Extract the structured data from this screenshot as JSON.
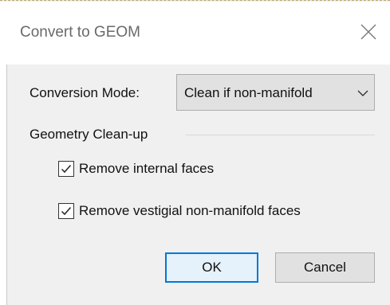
{
  "dialog": {
    "title": "Convert to GEOM",
    "conversion_mode": {
      "label": "Conversion Mode:",
      "selected": "Clean if non-manifold"
    },
    "group": {
      "label": "Geometry Clean-up",
      "options": [
        {
          "label": "Remove internal faces",
          "checked": true
        },
        {
          "label": "Remove vestigial non-manifold faces",
          "checked": true
        }
      ]
    },
    "buttons": {
      "ok": "OK",
      "cancel": "Cancel"
    }
  },
  "icons": {
    "close": "close-icon",
    "dropdown": "chevron-down-icon",
    "checkmark": "checkmark-icon"
  },
  "colors": {
    "accent": "#0078d7",
    "dialog_bg": "#f0f0f0",
    "title_bg": "#ffffff"
  }
}
